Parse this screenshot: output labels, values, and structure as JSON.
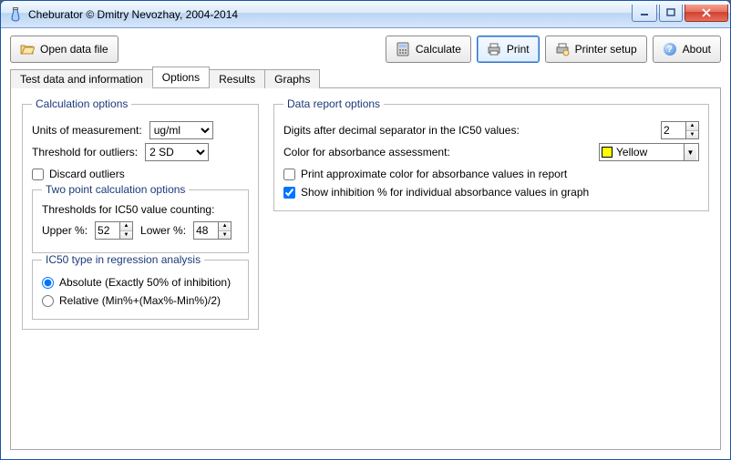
{
  "window": {
    "title": "Cheburator © Dmitry Nevozhay, 2004-2014"
  },
  "toolbar": {
    "open": "Open data file",
    "calculate": "Calculate",
    "print": "Print",
    "printer_setup": "Printer setup",
    "about": "About"
  },
  "tabs": [
    "Test data and information",
    "Options",
    "Results",
    "Graphs"
  ],
  "calc": {
    "legend": "Calculation options",
    "units_label": "Units of measurement:",
    "units_value": "ug/ml",
    "threshold_label": "Threshold for outliers:",
    "threshold_value": "2 SD",
    "discard_label": "Discard outliers",
    "twopoint": {
      "legend": "Two point calculation options",
      "thresholds_label": "Thresholds for IC50 value counting:",
      "upper_label": "Upper %:",
      "upper_value": "52",
      "lower_label": "Lower %:",
      "lower_value": "48"
    },
    "ic50type": {
      "legend": "IC50 type in regression analysis",
      "absolute": "Absolute (Exactly 50% of inhibition)",
      "relative": "Relative (Min%+(Max%-Min%)/2)"
    }
  },
  "report": {
    "legend": "Data report options",
    "digits_label": "Digits after decimal separator in the IC50 values:",
    "digits_value": "2",
    "color_label": "Color for absorbance assessment:",
    "color_name": "Yellow",
    "color_hex": "#ffff00",
    "print_approx": "Print approximate color for absorbance values in report",
    "show_inhib": "Show inhibition % for individual absorbance values in graph"
  }
}
